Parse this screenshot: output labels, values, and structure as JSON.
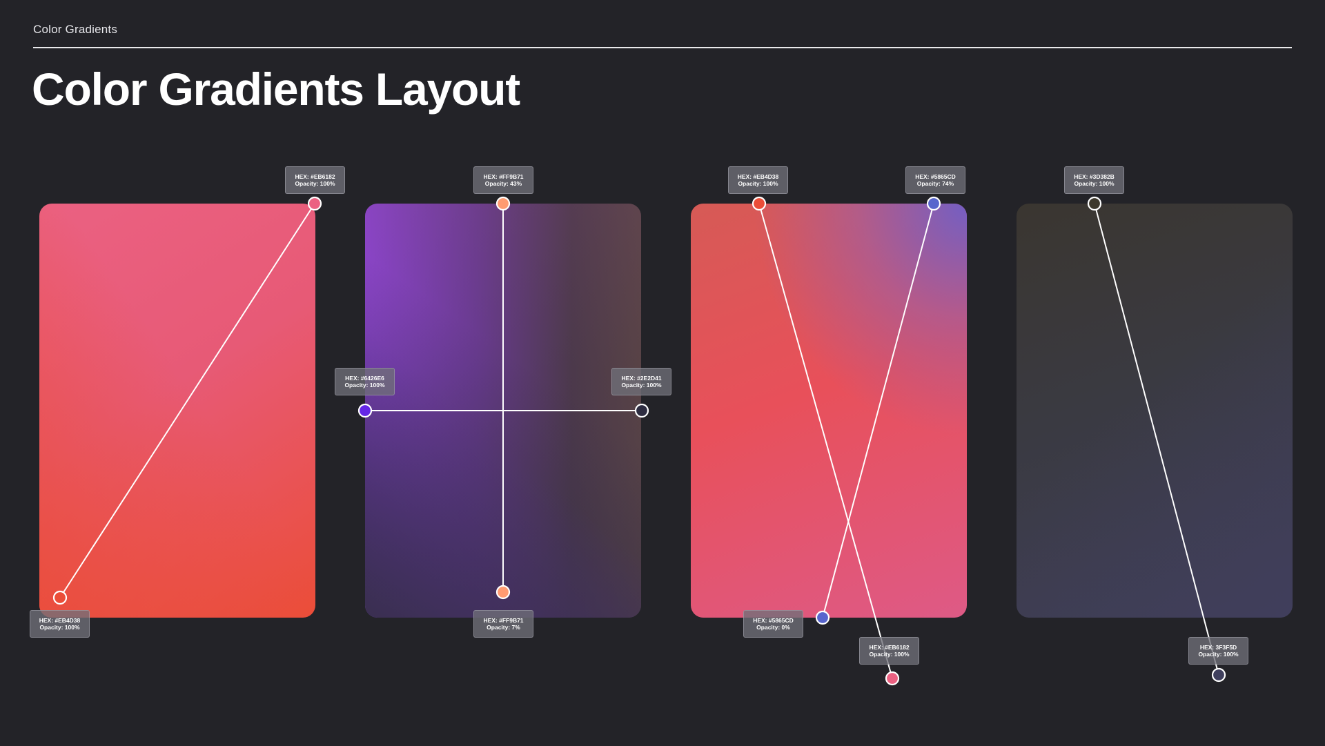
{
  "header": {
    "breadcrumb": "Color Gradients",
    "title": "Color Gradients Layout"
  },
  "cards": [
    {
      "name": "gradient-card-1",
      "stops": [
        {
          "hex": "HEX: #EB6182",
          "opacity": "Opacity: 100%",
          "color": "#EB6182"
        },
        {
          "hex": "HEX: #EB4D38",
          "opacity": "Opacity: 100%",
          "color": "#EB4D38"
        }
      ]
    },
    {
      "name": "gradient-card-2",
      "stops": [
        {
          "hex": "HEX: #FF9B71",
          "opacity": "Opacity: 43%",
          "color": "#FF9B71"
        },
        {
          "hex": "HEX: #6426E6",
          "opacity": "Opacity: 100%",
          "color": "#6426E6"
        },
        {
          "hex": "HEX: #2E2D41",
          "opacity": "Opacity: 100%",
          "color": "#2E2D41"
        },
        {
          "hex": "HEX: #FF9B71",
          "opacity": "Opacity: 7%",
          "color": "#FF9B71"
        }
      ]
    },
    {
      "name": "gradient-card-3",
      "stops": [
        {
          "hex": "HEX: #EB4D38",
          "opacity": "Opacity: 100%",
          "color": "#EB4D38"
        },
        {
          "hex": "HEX: #5865CD",
          "opacity": "Opacity: 74%",
          "color": "#5865CD"
        },
        {
          "hex": "HEX: #5865CD",
          "opacity": "Opacity: 0%",
          "color": "#5865CD"
        },
        {
          "hex": "HEX: #EB6182",
          "opacity": "Opacity: 100%",
          "color": "#EB6182"
        }
      ]
    },
    {
      "name": "gradient-card-4",
      "stops": [
        {
          "hex": "HEX: #3D382B",
          "opacity": "Opacity: 100%",
          "color": "#3D382B"
        },
        {
          "hex": "HEX: 3F3F5D",
          "opacity": "Opacity: 100%",
          "color": "#3F3F5D"
        }
      ]
    }
  ]
}
